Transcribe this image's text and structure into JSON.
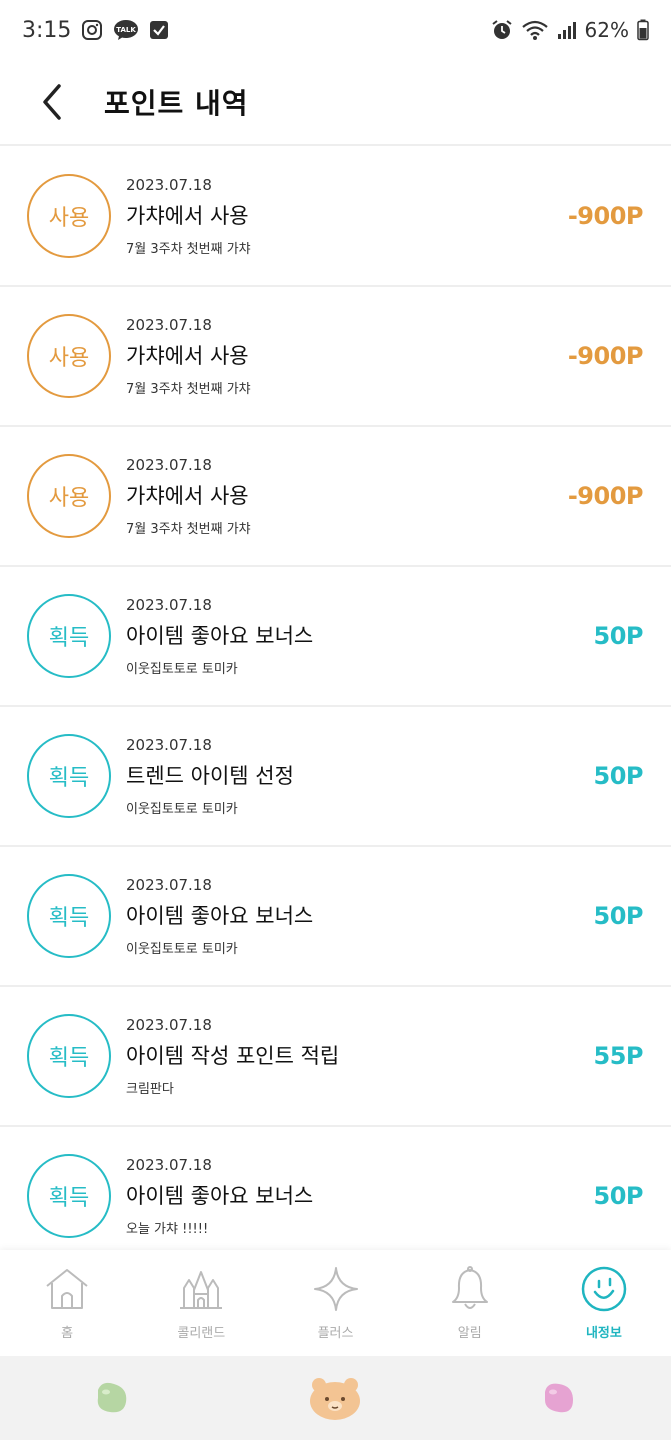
{
  "status_bar": {
    "time": "3:15",
    "battery": "62%"
  },
  "header": {
    "title": "포인트 내역"
  },
  "rows": [
    {
      "badge": "사용",
      "kind": "use",
      "date": "2023.07.18",
      "title": "가챠에서 사용",
      "sub": "7월 3주차 첫번째 가챠",
      "amount": "-900P"
    },
    {
      "badge": "사용",
      "kind": "use",
      "date": "2023.07.18",
      "title": "가챠에서 사용",
      "sub": "7월 3주차 첫번째 가챠",
      "amount": "-900P"
    },
    {
      "badge": "사용",
      "kind": "use",
      "date": "2023.07.18",
      "title": "가챠에서 사용",
      "sub": "7월 3주차 첫번째 가챠",
      "amount": "-900P"
    },
    {
      "badge": "획득",
      "kind": "earn",
      "date": "2023.07.18",
      "title": "아이템 좋아요 보너스",
      "sub": "이웃집토토로 토미카",
      "amount": "50P"
    },
    {
      "badge": "획득",
      "kind": "earn",
      "date": "2023.07.18",
      "title": "트렌드 아이템 선정",
      "sub": "이웃집토토로 토미카",
      "amount": "50P"
    },
    {
      "badge": "획득",
      "kind": "earn",
      "date": "2023.07.18",
      "title": "아이템 좋아요 보너스",
      "sub": "이웃집토토로 토미카",
      "amount": "50P"
    },
    {
      "badge": "획득",
      "kind": "earn",
      "date": "2023.07.18",
      "title": "아이템 작성 포인트 적립",
      "sub": "크림판다",
      "amount": "55P"
    },
    {
      "badge": "획득",
      "kind": "earn",
      "date": "2023.07.18",
      "title": "아이템 좋아요 보너스",
      "sub": "오늘 가챠 !!!!!",
      "amount": "50P"
    }
  ],
  "tabs": [
    {
      "label": "홈",
      "icon": "house-icon"
    },
    {
      "label": "콜리랜드",
      "icon": "castle-icon"
    },
    {
      "label": "플러스",
      "icon": "sparkle-icon"
    },
    {
      "label": "알림",
      "icon": "bell-icon"
    },
    {
      "label": "내정보",
      "icon": "smile-icon",
      "active": true
    }
  ],
  "colors": {
    "use": "#e39a3f",
    "earn": "#26bcc6",
    "active_tab": "#1fb5c0"
  }
}
